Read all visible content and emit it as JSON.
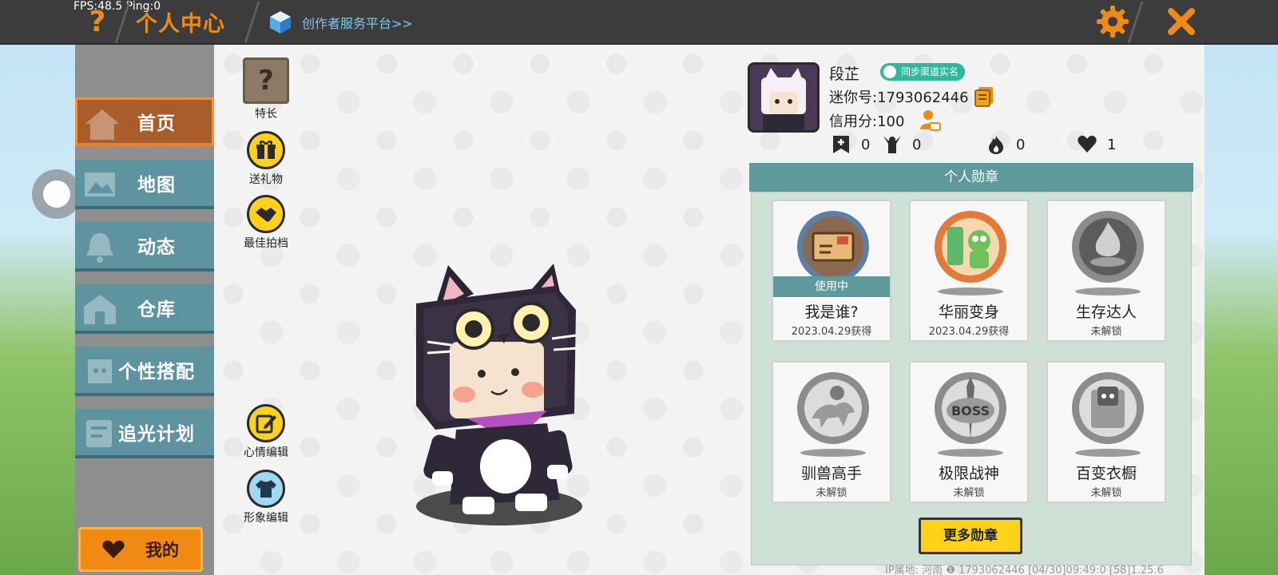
{
  "status": {
    "fps": "FPS:48.5  Ping:0"
  },
  "header": {
    "help_icon": "?",
    "title": "个人中心",
    "creator_link": "创作者服务平台>>",
    "accent": "#f08a12"
  },
  "sidebar": {
    "items": [
      {
        "label": "首页",
        "icon": "home-icon",
        "active": true
      },
      {
        "label": "地图",
        "icon": "map-icon"
      },
      {
        "label": "动态",
        "icon": "bell-icon"
      },
      {
        "label": "仓库",
        "icon": "house-icon"
      },
      {
        "label": "个性搭配",
        "icon": "outfit-icon"
      },
      {
        "label": "追光计划",
        "icon": "book-icon"
      }
    ],
    "mine_label": "我的"
  },
  "actions": {
    "specialty": "特长",
    "gift": "送礼物",
    "partner": "最佳拍档",
    "mood": "心情编辑",
    "appearance": "形象编辑"
  },
  "profile": {
    "name": "段芷",
    "verify": "同步渠道实名",
    "mini_id": "迷你号:1793062446",
    "credit": "信用分:100",
    "stats": {
      "a": "0",
      "b": "0",
      "c": "0",
      "d": "1"
    }
  },
  "medals": {
    "heading": "个人勋章",
    "cards": [
      {
        "title": "我是谁?",
        "sub": "2023.04.29获得",
        "badge": "使用中"
      },
      {
        "title": "华丽变身",
        "sub": "2023.04.29获得"
      },
      {
        "title": "生存达人",
        "sub": "未解锁"
      },
      {
        "title": "驯兽高手",
        "sub": "未解锁"
      },
      {
        "title": "极限战神",
        "sub": "未解锁"
      },
      {
        "title": "百变衣橱",
        "sub": "未解锁"
      }
    ],
    "more": "更多勋章"
  },
  "footer": {
    "info": "IP属地: 河南 ❶    1793062446    [04/30]09:49:0  [58]1.25.6"
  }
}
